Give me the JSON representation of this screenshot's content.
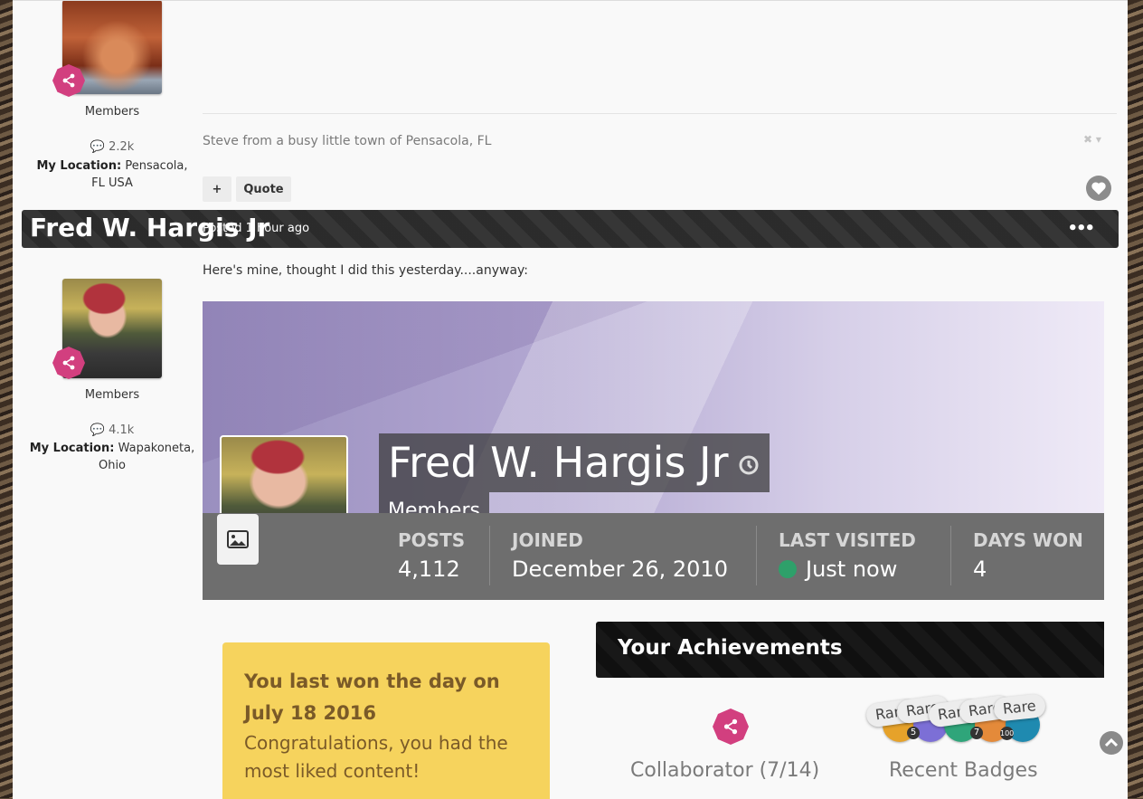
{
  "post1": {
    "group": "Members",
    "post_count": "2.2k",
    "location_label": "My Location:",
    "location_line1": "Pensacola,",
    "location_line2": "FL USA",
    "signature": "Steve from a busy little town of Pensacola, FL",
    "plus_label": "+",
    "quote_label": "Quote"
  },
  "post2": {
    "author": "Fred W. Hargis Jr",
    "posted": "Posted 1 hour ago",
    "menu": "•••",
    "group": "Members",
    "post_count": "4.1k",
    "location_label": "My Location:",
    "location_line1": "Wapakoneta,",
    "location_line2": "Ohio",
    "body": "Here's mine, thought I did this yesterday....anyway:"
  },
  "profile_card": {
    "name": "Fred W. Hargis Jr",
    "group": "Members",
    "stats": {
      "posts_label": "POSTS",
      "posts_value": "4,112",
      "joined_label": "JOINED",
      "joined_value": "December 26, 2010",
      "last_visited_label": "LAST VISITED",
      "last_visited_value": "Just now",
      "days_won_label": "DAYS WON",
      "days_won_value": "4"
    },
    "day_won": {
      "title_line1": "You last won the day on",
      "title_line2": "July 18 2016",
      "text_line1": "Congratulations, you had the",
      "text_line2": "most liked content!"
    },
    "achievements": {
      "title": "Your Achievements",
      "rank_caption": "Collaborator (7/14)",
      "badges_caption": "Recent Badges",
      "rare_label": "Rare",
      "badge_numbers": [
        "5",
        "7",
        "100"
      ]
    }
  },
  "colors": {
    "accent_badge": "#d23f7f",
    "header_bar": "#2e2e2e",
    "stats_bar": "#6e6e6e",
    "online": "#2ea06a",
    "day_won_bg": "#f6d35d"
  },
  "icons": [
    "share-icon",
    "comment-icon",
    "heart-icon",
    "image-icon",
    "chevron-up-icon",
    "history-icon",
    "close-icon"
  ]
}
